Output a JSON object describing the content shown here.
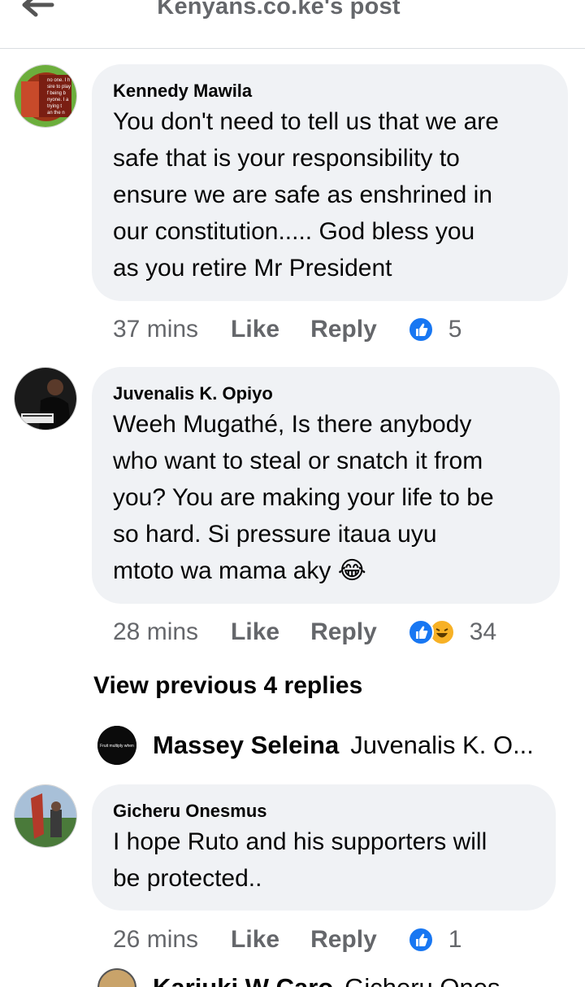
{
  "header": {
    "title": "Kenyans.co.ke's post"
  },
  "comments": [
    {
      "author": "Kennedy Mawila",
      "text": "You don't need to tell us that we are\nsafe that is your responsibility to\nensure we are safe as enshrined in\nour constitution..... God bless you\nas you retire Mr President",
      "time": "37 mins",
      "like_label": "Like",
      "reply_label": "Reply",
      "reaction_count": "5",
      "avatar_text": "no one. I h sire to play f being b nyone. I a trying t an the n"
    },
    {
      "author": "Juvenalis K. Opiyo",
      "text": "Weeh Mugathé, Is there anybody\nwho want to steal or snatch it from\nyou? You are making your life to be\nso hard. Si pressure itaua uyu\nmtoto wa mama aky 😂",
      "time": "28 mins",
      "like_label": "Like",
      "reply_label": "Reply",
      "reaction_count": "34"
    },
    {
      "author": "Gicheru Onesmus",
      "text": "I hope Ruto and his supporters will\nbe protected..",
      "time": "26 mins",
      "like_label": "Like",
      "reply_label": "Reply",
      "reaction_count": "1"
    }
  ],
  "view_previous": "View previous 4 replies",
  "reply_preview": {
    "author": "Massey Seleina",
    "text": "Juvenalis K. O...",
    "avatar_text": "Fruit multiply when"
  },
  "bottom_reply": {
    "author": "Kariuki W Caro",
    "text": "Gicheru Ones..."
  },
  "colors": {
    "like_blue": "#1877f2",
    "bubble_bg": "#f0f2f5",
    "meta_gray": "#65676b",
    "haha_yellow": "#f7b125"
  }
}
